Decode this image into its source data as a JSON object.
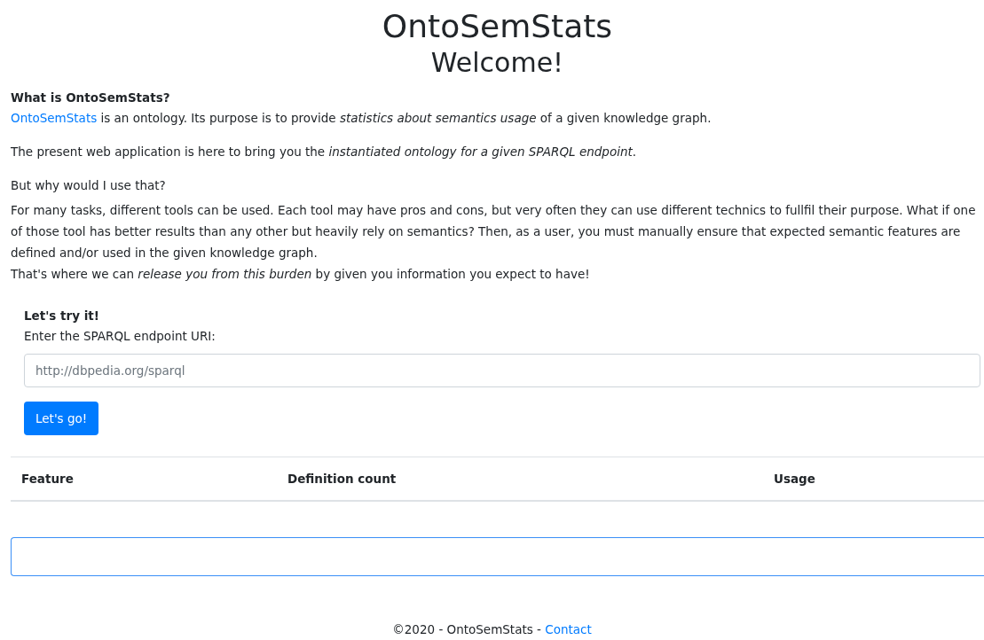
{
  "header": {
    "title": "OntoSemStats",
    "subtitle": "Welcome!"
  },
  "intro": {
    "heading": "What is OntoSemStats?",
    "paragraphs": [
      {
        "link": "OntoSemStats",
        "text": " is an ontology. Its purpose is to provide *statistics about semantics usage* of a given knowledge graph."
      },
      {
        "text": "The present web application is here to bring you the *instantiated ontology for a given SPARQL endpoint*."
      },
      {
        "text": "But why would I use that?"
      },
      {
        "text": "For many tasks, different tools can be used. Each tool may have pros and cons, but very often they can use different technics to fullfil their purpose. What if one of those tool has better results than any other but heavily rely on semantics? Then, as a user, you must manually ensure that expected semantic features are defined and/or used in the given knowledge graph."
      },
      {
        "text": "That's where we can *release you from this burden* by given you information you expect to have!"
      }
    ]
  },
  "form": {
    "heading": "Let's try it!",
    "label": "Enter the SPARQL endpoint URI:",
    "placeholder": "http://dbpedia.org/sparql",
    "button": "Let's go!"
  },
  "table": {
    "columns": [
      "Feature",
      "Definition count",
      "Usage"
    ]
  },
  "output": {
    "focused": true
  },
  "footer": {
    "text": "©2020 - OntoSemStats - ",
    "link": "Contact"
  }
}
